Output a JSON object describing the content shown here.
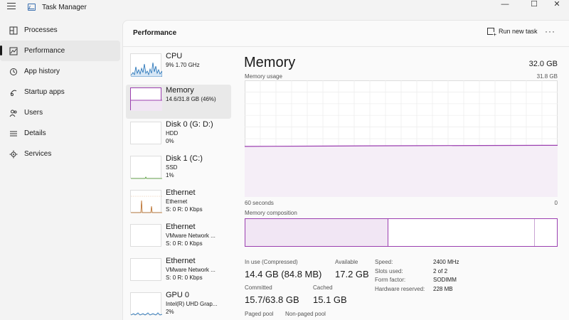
{
  "window": {
    "title": "Task Manager",
    "controls": {
      "minimize": "—",
      "maximize": "☐",
      "close": "✕"
    }
  },
  "sidebar": {
    "items": [
      {
        "label": "Processes",
        "icon": "processes-icon",
        "active": false
      },
      {
        "label": "Performance",
        "icon": "performance-icon",
        "active": true
      },
      {
        "label": "App history",
        "icon": "history-icon",
        "active": false
      },
      {
        "label": "Startup apps",
        "icon": "startup-icon",
        "active": false
      },
      {
        "label": "Users",
        "icon": "users-icon",
        "active": false
      },
      {
        "label": "Details",
        "icon": "details-icon",
        "active": false
      },
      {
        "label": "Services",
        "icon": "services-icon",
        "active": false
      }
    ]
  },
  "header": {
    "title": "Performance",
    "run_new_task": "Run new task",
    "more": "···"
  },
  "devices": [
    {
      "name": "CPU",
      "line1": "9%  1.70 GHz",
      "line2": "",
      "thumb_color": "#1f6fb5",
      "active": false
    },
    {
      "name": "Memory",
      "line1": "14.6/31.8 GB (46%)",
      "line2": "",
      "thumb_color": "#9b3fb0",
      "active": true
    },
    {
      "name": "Disk 0 (G: D:)",
      "line1": "HDD",
      "line2": "0%",
      "thumb_color": "#4a9a2a",
      "active": false
    },
    {
      "name": "Disk 1 (C:)",
      "line1": "SSD",
      "line2": "1%",
      "thumb_color": "#4a9a2a",
      "active": false
    },
    {
      "name": "Ethernet",
      "line1": "Ethernet",
      "line2": "S: 0 R: 0 Kbps",
      "thumb_color": "#b5651d",
      "active": false
    },
    {
      "name": "Ethernet",
      "line1": "VMware Network ...",
      "line2": "S: 0 R: 0 Kbps",
      "thumb_color": "#b5651d",
      "active": false
    },
    {
      "name": "Ethernet",
      "line1": "VMware Network ...",
      "line2": "S: 0 R: 0 Kbps",
      "thumb_color": "#b5651d",
      "active": false
    },
    {
      "name": "GPU 0",
      "line1": "Intel(R) UHD Grap...",
      "line2": "2%",
      "thumb_color": "#1f6fb5",
      "active": false
    }
  ],
  "memory": {
    "title": "Memory",
    "total": "32.0 GB",
    "usage_label": "Memory usage",
    "usage_max": "31.8 GB",
    "axis_left": "60 seconds",
    "axis_right": "0",
    "usage_fraction": 0.46,
    "composition_label": "Memory composition",
    "composition": {
      "in_use": 0.46,
      "modified": 0.47,
      "standby": 0.065
    },
    "accent": "#9b3fb0",
    "stats": {
      "in_use_label": "In use (Compressed)",
      "in_use_value": "14.4 GB (84.8 MB)",
      "available_label": "Available",
      "available_value": "17.2 GB",
      "committed_label": "Committed",
      "committed_value": "15.7/63.8 GB",
      "cached_label": "Cached",
      "cached_value": "15.1 GB",
      "paged_label": "Paged pool",
      "nonpaged_label": "Non-paged pool"
    },
    "specs": [
      {
        "label": "Speed:",
        "value": "2400 MHz"
      },
      {
        "label": "Slots used:",
        "value": "2 of 2"
      },
      {
        "label": "Form factor:",
        "value": "SODIMM"
      },
      {
        "label": "Hardware reserved:",
        "value": "228 MB"
      }
    ]
  }
}
